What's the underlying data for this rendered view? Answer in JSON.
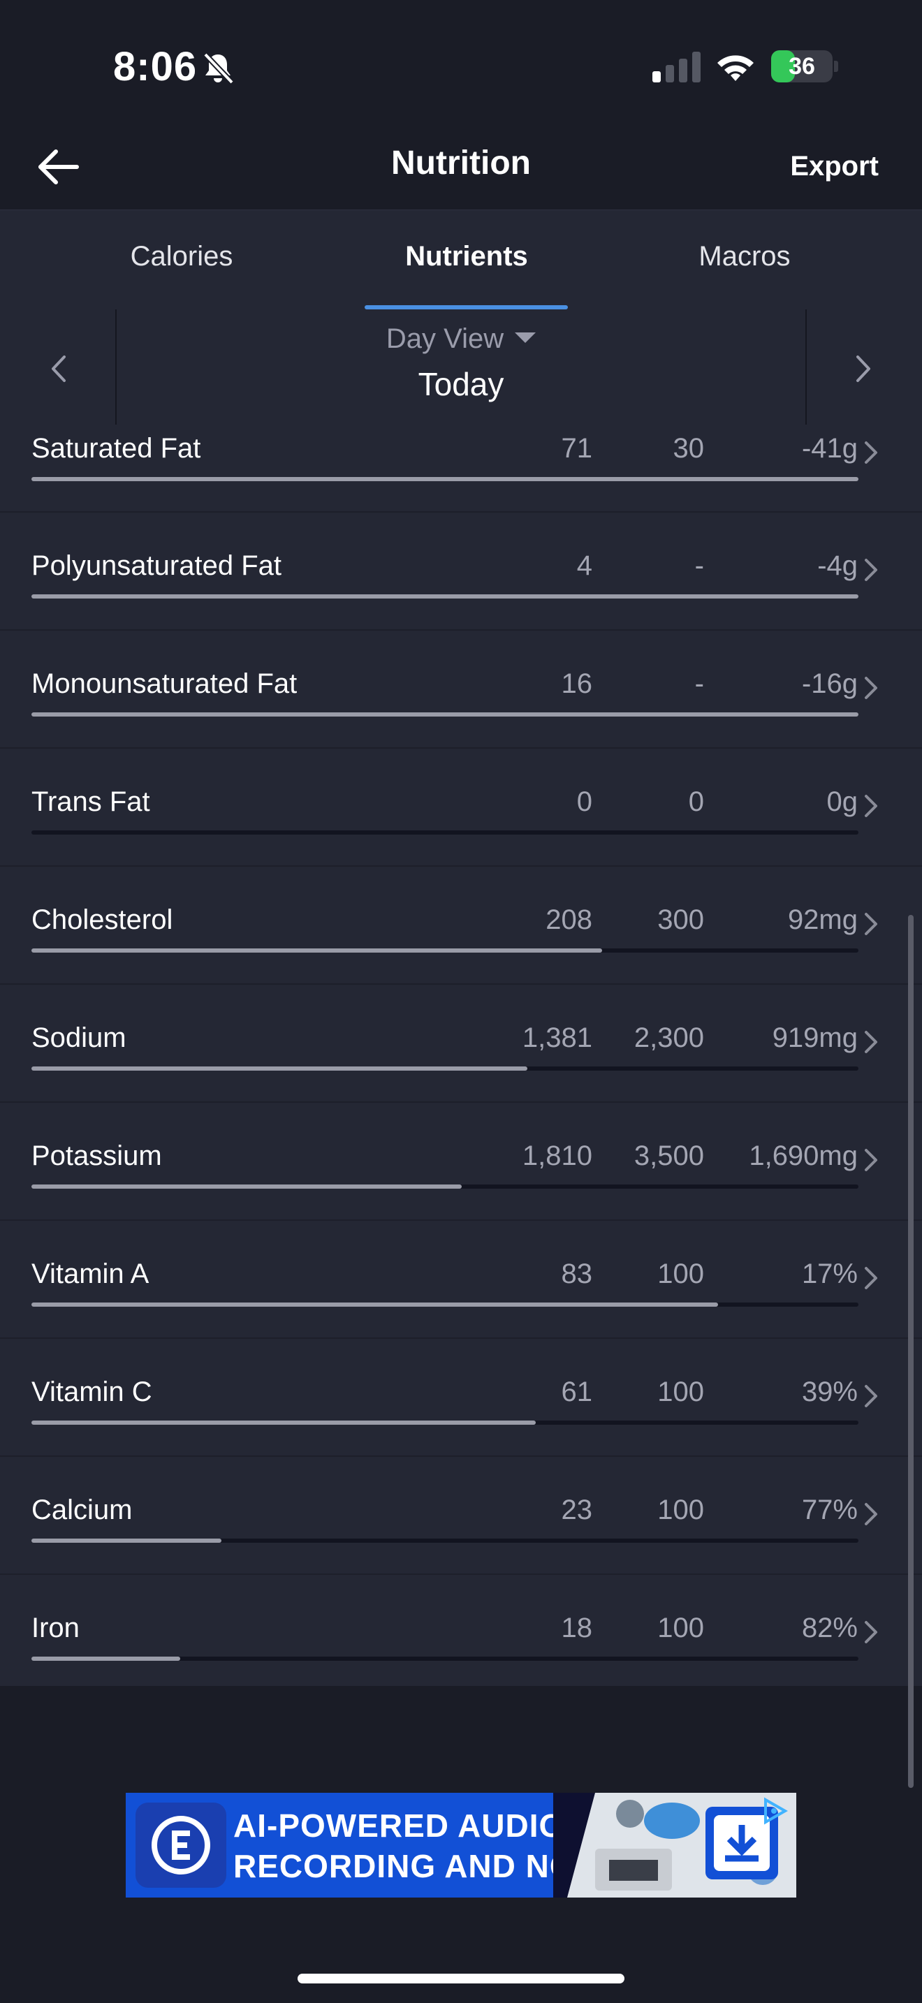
{
  "status_bar": {
    "time": "8:06",
    "battery": "36"
  },
  "nav": {
    "title": "Nutrition",
    "export_label": "Export"
  },
  "tabs": [
    {
      "label": "Calories",
      "active": false
    },
    {
      "label": "Nutrients",
      "active": true
    },
    {
      "label": "Macros",
      "active": false
    }
  ],
  "day_selector": {
    "view_label": "Day View",
    "date_label": "Today"
  },
  "nutrients": [
    {
      "name": "Saturated Fat",
      "total": "71",
      "goal": "30",
      "left": "-41g",
      "progress": 1.0
    },
    {
      "name": "Polyunsaturated Fat",
      "total": "4",
      "goal": "-",
      "left": "-4g",
      "progress": 1.0
    },
    {
      "name": "Monounsaturated Fat",
      "total": "16",
      "goal": "-",
      "left": "-16g",
      "progress": 1.0
    },
    {
      "name": "Trans Fat",
      "total": "0",
      "goal": "0",
      "left": "0g",
      "progress": 0.0
    },
    {
      "name": "Cholesterol",
      "total": "208",
      "goal": "300",
      "left": "92mg",
      "progress": 0.69
    },
    {
      "name": "Sodium",
      "total": "1,381",
      "goal": "2,300",
      "left": "919mg",
      "progress": 0.6
    },
    {
      "name": "Potassium",
      "total": "1,810",
      "goal": "3,500",
      "left": "1,690mg",
      "progress": 0.52
    },
    {
      "name": "Vitamin A",
      "total": "83",
      "goal": "100",
      "left": "17%",
      "progress": 0.83
    },
    {
      "name": "Vitamin C",
      "total": "61",
      "goal": "100",
      "left": "39%",
      "progress": 0.61
    },
    {
      "name": "Calcium",
      "total": "23",
      "goal": "100",
      "left": "77%",
      "progress": 0.23
    },
    {
      "name": "Iron",
      "total": "18",
      "goal": "100",
      "left": "82%",
      "progress": 0.18
    }
  ],
  "ad": {
    "line1": "AI-POWERED AUDIO",
    "line2": "RECORDING AND NOTES"
  },
  "colors": {
    "accent": "#4a90e2",
    "background": "#1a1c26",
    "panel": "#242734",
    "battery": "#34c759",
    "ad_blue": "#1250d6"
  }
}
